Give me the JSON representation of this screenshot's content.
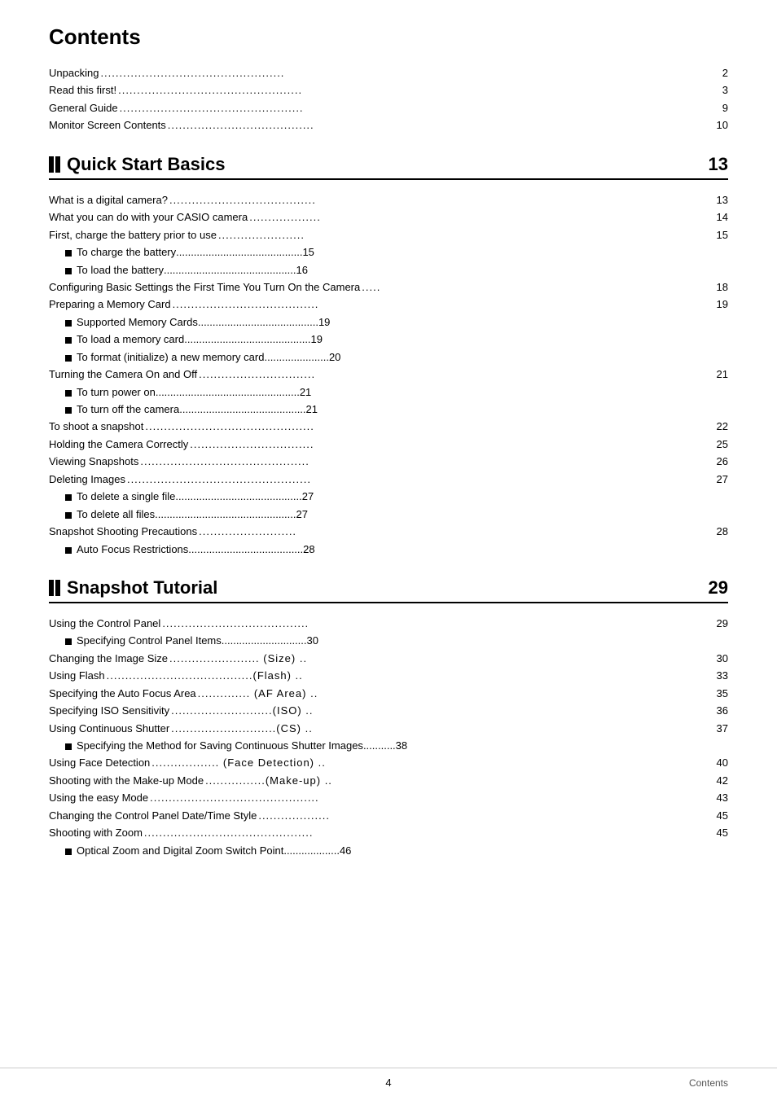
{
  "page": {
    "title": "Contents",
    "footer_page": "4",
    "footer_label": "Contents"
  },
  "intro_entries": [
    {
      "label": "Unpacking",
      "dots": ".................................................",
      "page": "2"
    },
    {
      "label": "Read this first!",
      "dots": ".................................................",
      "page": "3"
    },
    {
      "label": "General Guide",
      "dots": ".................................................",
      "page": "9"
    },
    {
      "label": "Monitor Screen Contents",
      "dots": ".......................................",
      "page": "10"
    }
  ],
  "section1": {
    "title": "Quick Start Basics",
    "page": "13",
    "entries": [
      {
        "type": "normal",
        "label": "What is a digital camera?",
        "dots": ".......................................",
        "page": "13"
      },
      {
        "type": "normal",
        "label": "What you can do with your CASIO camera",
        "dots": "...................",
        "page": "14"
      },
      {
        "type": "normal",
        "label": "First, charge the battery prior to use",
        "dots": ".......................",
        "page": "15"
      },
      {
        "type": "bullet",
        "label": "To charge the battery",
        "dots": "...........................................",
        "page": "15"
      },
      {
        "type": "bullet",
        "label": "To load the battery",
        "dots": ".............................................",
        "page": "16"
      },
      {
        "type": "normal",
        "label": "Configuring Basic Settings the First Time You Turn On the Camera",
        "dots": ".....",
        "page": "18"
      },
      {
        "type": "normal",
        "label": "Preparing a Memory Card",
        "dots": ".......................................",
        "page": "19"
      },
      {
        "type": "bullet",
        "label": "Supported Memory Cards",
        "dots": ".........................................",
        "page": "19"
      },
      {
        "type": "bullet",
        "label": "To load a memory card",
        "dots": "...........................................",
        "page": "19"
      },
      {
        "type": "bullet",
        "label": "To format (initialize) a new memory card",
        "dots": "......................",
        "page": "20"
      },
      {
        "type": "normal",
        "label": "Turning the Camera On and Off",
        "dots": "...............................",
        "page": "21"
      },
      {
        "type": "bullet",
        "label": "To turn power on",
        "dots": ".................................................",
        "page": "21"
      },
      {
        "type": "bullet",
        "label": "To turn off the camera",
        "dots": "...........................................",
        "page": "21"
      },
      {
        "type": "normal",
        "label": "To shoot a snapshot",
        "dots": ".............................................",
        "page": "22"
      },
      {
        "type": "normal",
        "label": "Holding the Camera Correctly",
        "dots": ".................................",
        "page": "25"
      },
      {
        "type": "normal",
        "label": "Viewing Snapshots",
        "dots": ".............................................",
        "page": "26"
      },
      {
        "type": "normal",
        "label": "Deleting Images",
        "dots": ".................................................",
        "page": "27"
      },
      {
        "type": "bullet",
        "label": "To delete a single file",
        "dots": "...........................................",
        "page": "27"
      },
      {
        "type": "bullet",
        "label": "To delete all files",
        "dots": "................................................",
        "page": "27"
      },
      {
        "type": "normal",
        "label": "Snapshot Shooting Precautions",
        "dots": "..........................",
        "page": "28"
      },
      {
        "type": "bullet",
        "label": "Auto Focus Restrictions",
        "dots": ".......................................",
        "page": "28"
      }
    ]
  },
  "section2": {
    "title": "Snapshot Tutorial",
    "page": "29",
    "entries": [
      {
        "type": "normal",
        "label": "Using the Control Panel",
        "dots": ".......................................",
        "page": "29"
      },
      {
        "type": "bullet",
        "label": "Specifying Control Panel Items",
        "dots": ".............................",
        "page": "30"
      },
      {
        "type": "normal",
        "label": "Changing the Image Size",
        "dots": "........................ (Size) ..",
        "page": "30"
      },
      {
        "type": "normal",
        "label": "Using Flash",
        "dots": ".......................................(Flash) ..",
        "page": "33"
      },
      {
        "type": "normal",
        "label": "Specifying the Auto Focus Area",
        "dots": ".............. (AF Area) ..",
        "page": "35"
      },
      {
        "type": "normal",
        "label": "Specifying ISO Sensitivity",
        "dots": "...........................(ISO) ..",
        "page": "36"
      },
      {
        "type": "normal",
        "label": "Using Continuous Shutter",
        "dots": "............................(CS) ..",
        "page": "37"
      },
      {
        "type": "bullet",
        "label": "Specifying the Method for Saving Continuous Shutter Images",
        "dots": "...........",
        "page": "38"
      },
      {
        "type": "normal",
        "label": "Using Face Detection",
        "dots": ".................. (Face Detection) ..",
        "page": "40"
      },
      {
        "type": "normal",
        "label": "Shooting with the Make-up Mode",
        "dots": "................(Make-up) ..",
        "page": "42"
      },
      {
        "type": "normal",
        "label": "Using the easy Mode",
        "dots": ".............................................",
        "page": "43"
      },
      {
        "type": "normal",
        "label": "Changing the Control Panel Date/Time Style",
        "dots": "...................",
        "page": "45"
      },
      {
        "type": "normal",
        "label": "Shooting with Zoom",
        "dots": ".............................................",
        "page": "45"
      },
      {
        "type": "bullet",
        "label": "Optical Zoom and Digital Zoom Switch Point",
        "dots": "...................",
        "page": "46"
      }
    ]
  }
}
